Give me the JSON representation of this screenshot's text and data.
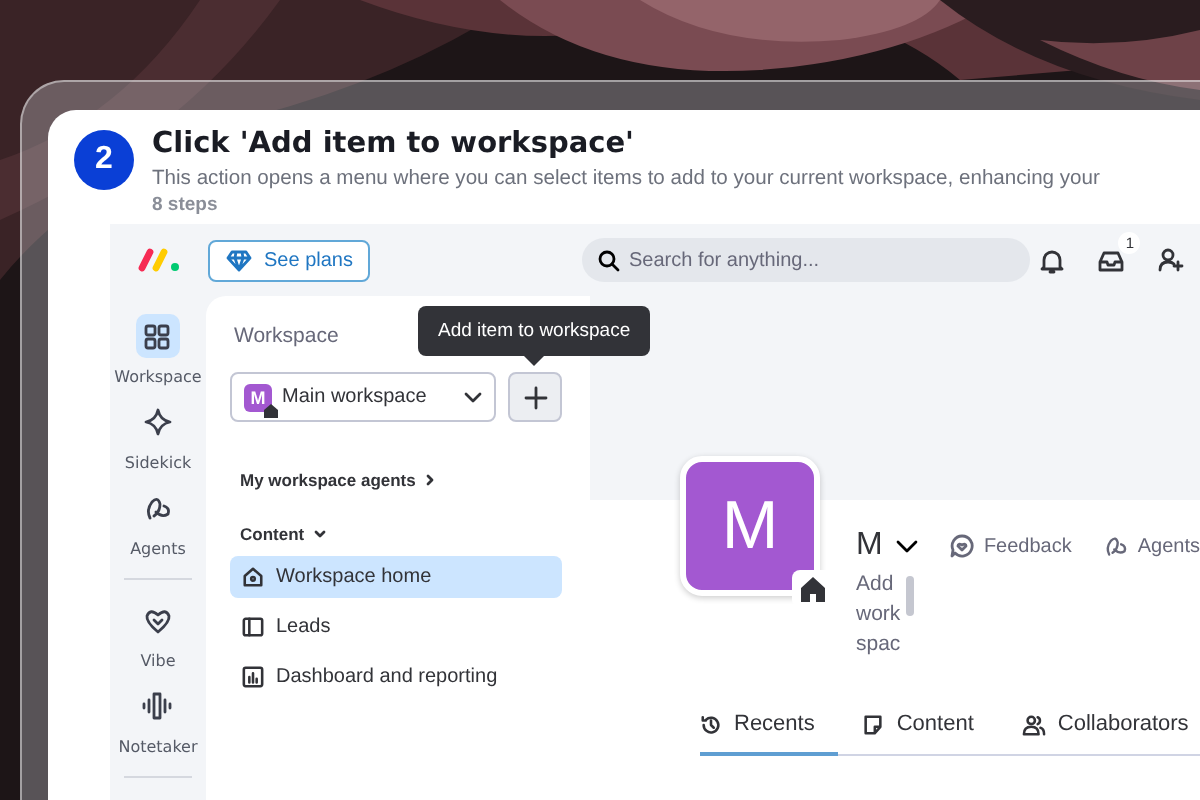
{
  "tour": {
    "step": "2",
    "title": "Click 'Add item to workspace'",
    "description": "This action opens a menu where you can select items to add to your current workspace, enhancing your",
    "steps_count": "8 steps"
  },
  "topbar": {
    "see_plans": "See plans",
    "search": {
      "placeholder": "Search for anything..."
    },
    "inbox_badge": "1"
  },
  "rail": [
    {
      "label": "Workspace",
      "selected": true
    },
    {
      "label": "Sidekick",
      "selected": false
    },
    {
      "label": "Agents",
      "selected": false
    },
    {
      "label": "Vibe",
      "selected": false
    },
    {
      "label": "Notetaker",
      "selected": false
    }
  ],
  "sidebar": {
    "heading": "Workspace",
    "workspace_select": {
      "avatar": "M",
      "value": "Main workspace"
    },
    "tooltip": "Add item to workspace",
    "agents_link": "My workspace agents",
    "content_heading": "Content",
    "items": [
      {
        "label": "Workspace home",
        "selected": true
      },
      {
        "label": "Leads",
        "selected": false
      },
      {
        "label": "Dashboard and reporting",
        "selected": false
      }
    ]
  },
  "workspace": {
    "avatar": "M",
    "name": "M",
    "description": "Add workspac",
    "actions": [
      "Feedback",
      "Agents"
    ],
    "tabs": [
      {
        "label": "Recents",
        "selected": true
      },
      {
        "label": "Content",
        "selected": false
      },
      {
        "label": "Collaborators",
        "selected": false
      }
    ]
  }
}
